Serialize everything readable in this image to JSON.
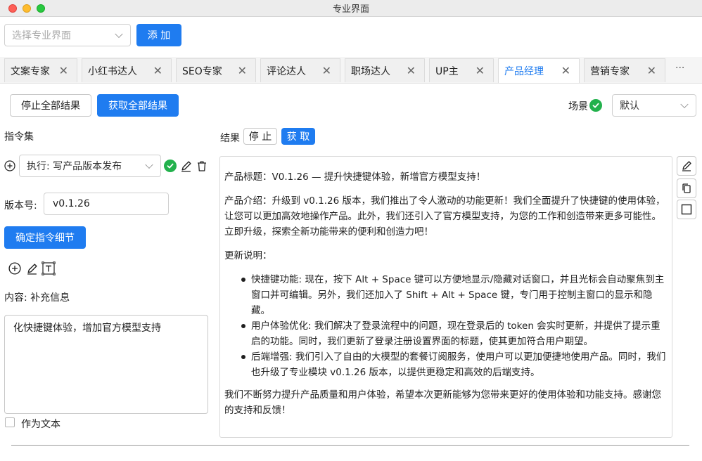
{
  "window": {
    "title": "专业界面"
  },
  "top": {
    "select_placeholder": "选择专业界面",
    "add_label": "添 加"
  },
  "tabs": [
    {
      "label": "文案专家",
      "active": false
    },
    {
      "label": "小红书达人",
      "active": false
    },
    {
      "label": "SEO专家",
      "active": false
    },
    {
      "label": "评论达人",
      "active": false
    },
    {
      "label": "职场达人",
      "active": false
    },
    {
      "label": "UP主",
      "active": false
    },
    {
      "label": "产品经理",
      "active": true
    },
    {
      "label": "营销专家",
      "active": false
    }
  ],
  "tab_close_glyph": "✕",
  "tab_more": "···",
  "actions": {
    "stop_all": "停止全部结果",
    "get_all": "获取全部结果",
    "scene_label": "场景",
    "scene_value": "默认"
  },
  "left": {
    "instructions_title": "指令集",
    "exec_select": "执行: 写产品版本发布",
    "version_label": "版本号:",
    "version_value": "v0.1.26",
    "confirm_button": "确定指令细节",
    "content_label": "内容: 补充信息",
    "content_text": "化快捷键体验，增加官方模型支持",
    "as_text_label": "作为文本"
  },
  "results": {
    "label": "结果",
    "stop_button": "停 止",
    "get_button": "获 取",
    "paragraphs": [
      "产品标题：V0.1.26 — 提升快捷键体验，新增官方模型支持！",
      "产品介绍：升级到 v0.1.26 版本，我们推出了令人激动的功能更新！我们全面提升了快捷键的使用体验，让您可以更加高效地操作产品。此外，我们还引入了官方模型支持，为您的工作和创造带来更多可能性。立即升级，探索全新功能带来的便利和创造力吧！",
      "更新说明："
    ],
    "bullets": [
      "快捷键功能: 现在，按下 Alt + Space 键可以方便地显示/隐藏对话窗口，并且光标会自动聚焦到主窗口并可编辑。另外，我们还加入了 Shift + Alt + Space 键，专门用于控制主窗口的显示和隐藏。",
      "用户体验优化: 我们解决了登录流程中的问题，现在登录后的 token 会实时更新，并提供了提示重启的功能。同时，我们更新了登录注册设置界面的标题，使其更加符合用户期望。",
      "后端增强: 我们引入了自由的大模型的套餐订阅服务，使用户可以更加便捷地使用产品。同时，我们也升级了专业模块 v0.1.26 版本，以提供更稳定和高效的后端支持。"
    ],
    "closing": "我们不断努力提升产品质量和用户体验，希望本次更新能够为您带来更好的使用体验和功能支持。感谢您的支持和反馈！"
  },
  "colors": {
    "accent": "#1f7cf0",
    "success": "#22b14c"
  }
}
